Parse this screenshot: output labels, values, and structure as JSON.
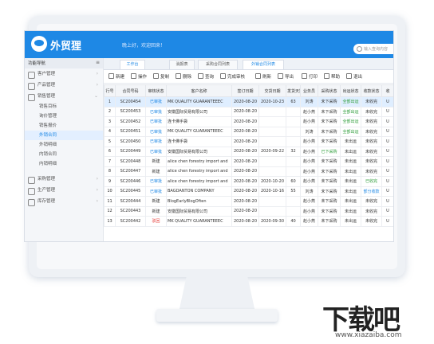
{
  "app": {
    "logo": "外贸狸",
    "welcome": "晚上好，欢迎回来！"
  },
  "search": {
    "placeholder": "输入查询内容"
  },
  "sidebar": {
    "title": "功能导航",
    "groups": [
      {
        "label": "客户管理"
      },
      {
        "label": "产品管理"
      },
      {
        "label": "销售管理"
      }
    ],
    "subs": [
      "销售目标",
      "询价管理",
      "销售报价",
      "外销合同",
      "外销明细",
      "内销合同",
      "内销明细"
    ],
    "bottom": [
      {
        "label": "采购管理"
      },
      {
        "label": "生产管理"
      },
      {
        "label": "库存管理"
      }
    ]
  },
  "tabs": [
    "工作台",
    "消报表",
    "采购合同列表",
    "外销合同列表"
  ],
  "toolbar": [
    "新建",
    "操作",
    "复制",
    "删除",
    "查询",
    "完成审核",
    "刷新",
    "导出",
    "打印",
    "帮助",
    "退出"
  ],
  "table": {
    "headers": [
      "行号",
      "合同号码",
      "审核状态",
      "客户名称",
      "签订日期",
      "交货日期",
      "发货天数",
      "业务员",
      "采购状态",
      "出运状态",
      "收款状态",
      "收"
    ],
    "rows": [
      [
        "1",
        "SC200454",
        "已审批",
        "MK QUALITY GUARANTEEEC",
        "2020-08-20",
        "2020-10-23",
        "63",
        "刘涛",
        "未下采购",
        "全部出运",
        "未收完",
        "U"
      ],
      [
        "2",
        "SC200453",
        "已审批",
        "安徽国际贸易有限公司",
        "2020-08-20",
        "",
        "",
        "赵小燕",
        "未下采购",
        "全部出运",
        "未收完",
        "U"
      ],
      [
        "3",
        "SC200452",
        "已审批",
        "连卡佛手袋",
        "2020-08-20",
        "",
        "",
        "赵小燕",
        "未下采购",
        "全部出运",
        "未收完",
        "U"
      ],
      [
        "4",
        "SC200451",
        "已审批",
        "MK QUALITY GUARANTEEEC",
        "2020-08-20",
        "",
        "",
        "刘涛",
        "未下采购",
        "全部出运",
        "未收完",
        "U"
      ],
      [
        "5",
        "SC200450",
        "已审批",
        "连卡佛手袋",
        "2020-08-20",
        "",
        "",
        "赵小燕",
        "未下采购",
        "未出运",
        "未收完",
        "U"
      ],
      [
        "6",
        "SC200449",
        "已审批",
        "安徽国际贸易有限公司",
        "2020-08-20",
        "2020-09-22",
        "32",
        "赵小燕",
        "已下采购",
        "未出运",
        "未收完",
        "U"
      ],
      [
        "7",
        "SC200448",
        "新建",
        "alice chen forestry import and",
        "2020-08-20",
        "",
        "",
        "赵小燕",
        "未下采购",
        "未出运",
        "未收完",
        "U"
      ],
      [
        "8",
        "SC200447",
        "新建",
        "alice chen forestry import and",
        "2020-08-20",
        "",
        "",
        "赵小燕",
        "未下采购",
        "未出运",
        "未收完",
        "U"
      ],
      [
        "9",
        "SC200446",
        "已审批",
        "alice chen forestry import and",
        "2020-08-20",
        "2020-10-20",
        "60",
        "赵小燕",
        "未下采购",
        "未出运",
        "已收完",
        "U"
      ],
      [
        "10",
        "SC200445",
        "已审批",
        "BAGDANTON COMPANY",
        "2020-08-20",
        "2020-10-16",
        "55",
        "刘涛",
        "未下采购",
        "未出运",
        "部分收款",
        "U"
      ],
      [
        "11",
        "SC200444",
        "新建",
        "BlogEarlyBlogOften",
        "2020-08-20",
        "",
        "",
        "赵小燕",
        "未下采购",
        "未出运",
        "未收完",
        "U"
      ],
      [
        "12",
        "SC200443",
        "新建",
        "安徽国际贸易有限公司",
        "2020-08-20",
        "",
        "",
        "赵小燕",
        "未下采购",
        "未出运",
        "未收完",
        "U"
      ],
      [
        "13",
        "SC200442",
        "驳回",
        "MK QUALITY GUARANTEEEC",
        "2020-08-20",
        "2020-09-30",
        "40",
        "赵小燕",
        "未下采购",
        "未出运",
        "未收完",
        "U"
      ]
    ]
  },
  "watermark": {
    "brand": "下载吧",
    "url": "www.xiazaiba.com"
  },
  "colors": {
    "accent": "#1e88e5",
    "approved": "#1e88e5",
    "new": "#333333",
    "rejected": "#e53935"
  }
}
